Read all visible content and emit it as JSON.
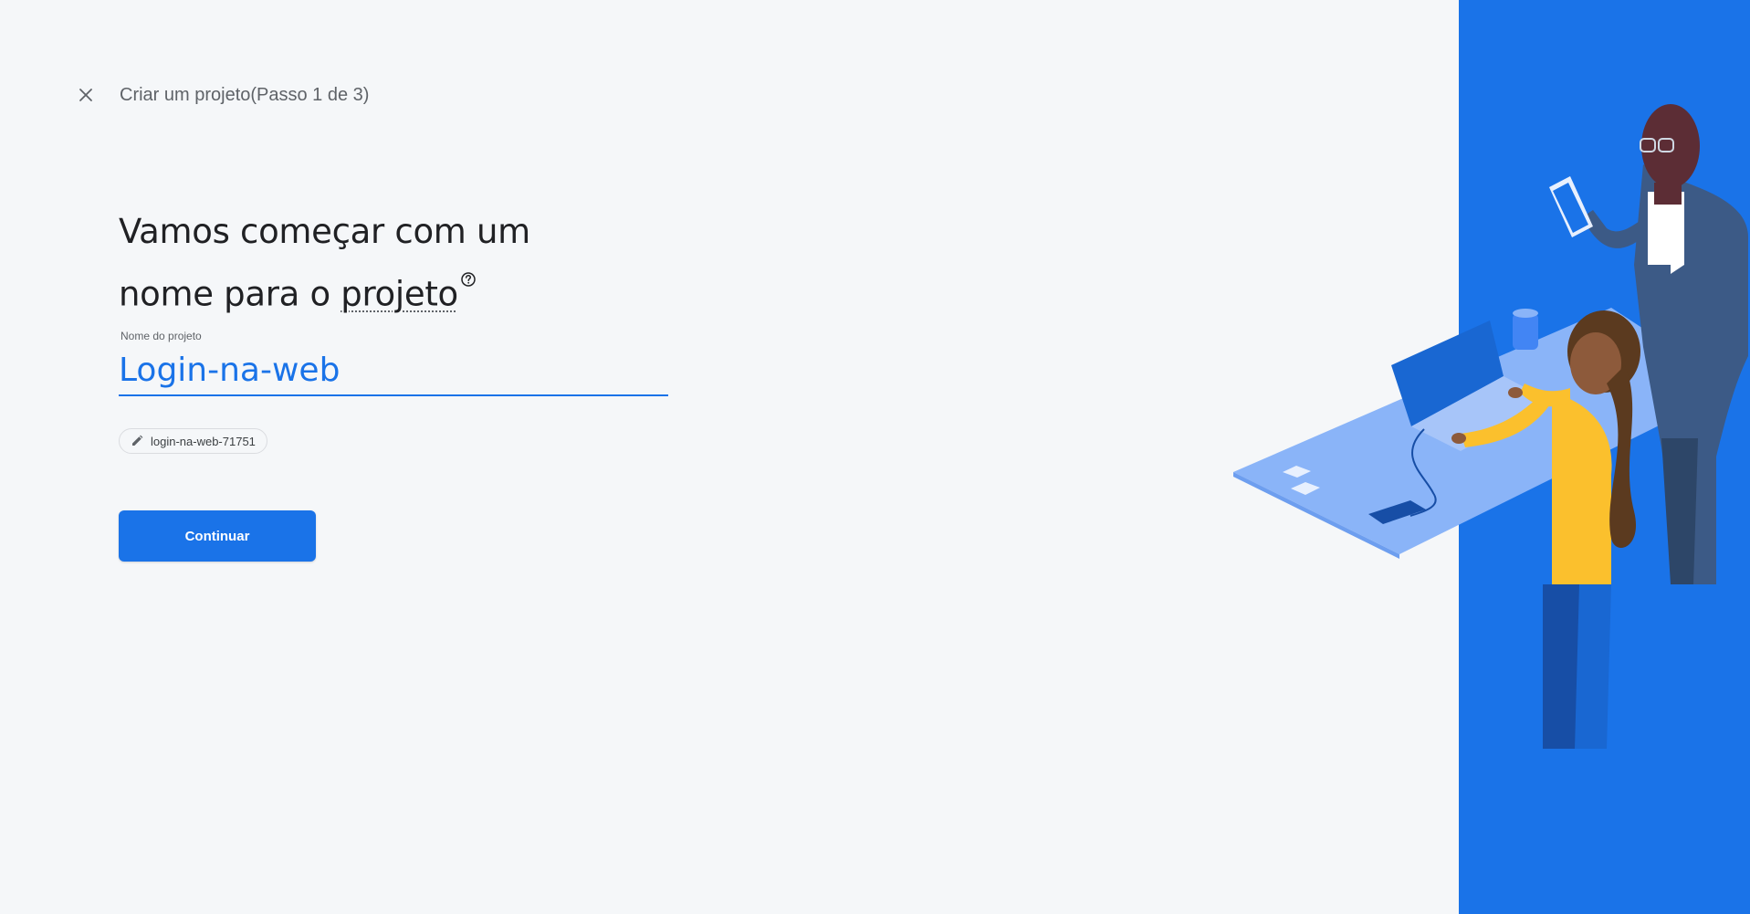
{
  "header": {
    "step_title": "Criar um projeto(Passo 1 de 3)",
    "close_icon": "close-icon"
  },
  "main": {
    "headline_line1": "Vamos começar com um",
    "headline_line2_prefix": "nome para o ",
    "headline_term": "projeto",
    "help_icon": "help-icon",
    "field_label": "Nome do projeto",
    "project_name_value": "Login-na-web",
    "project_id_chip": "login-na-web-71751",
    "edit_icon": "pencil-icon",
    "continue_label": "Continuar"
  },
  "colors": {
    "accent": "#1a73e8",
    "background": "#f5f7f9",
    "text_primary": "#202124",
    "text_secondary": "#5f6368"
  }
}
